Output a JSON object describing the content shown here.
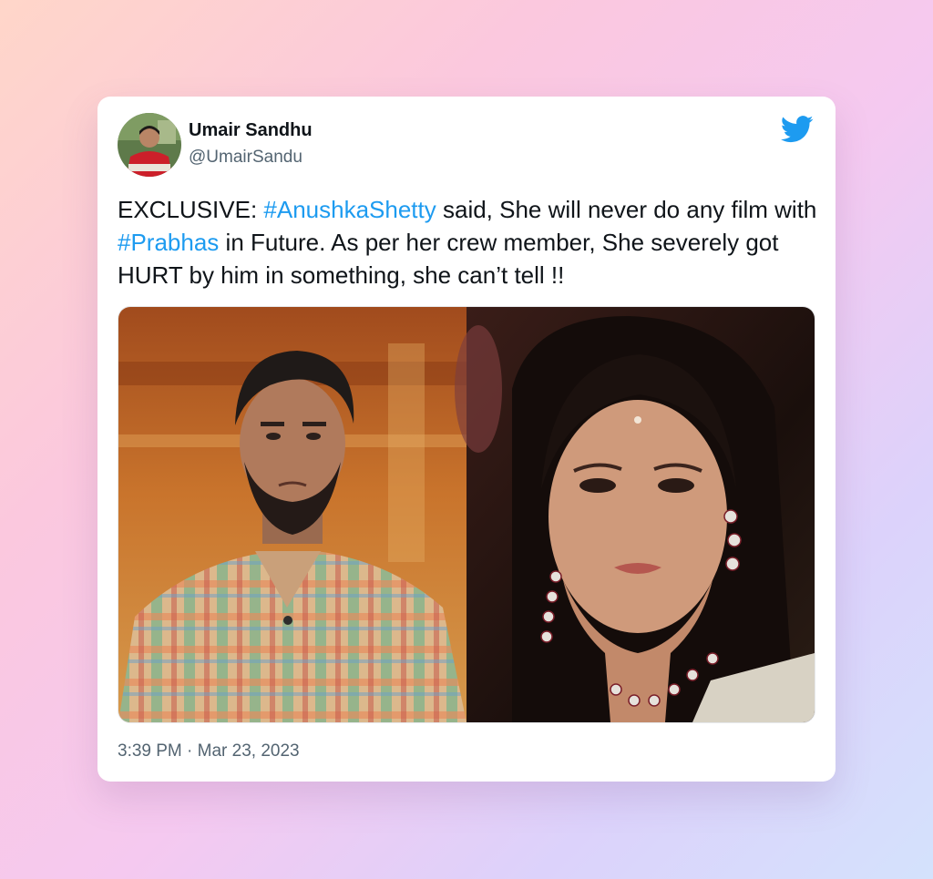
{
  "tweet": {
    "author": {
      "display_name": "Umair Sandhu",
      "handle": "@UmairSandu",
      "avatar": "profile-photo"
    },
    "icons": {
      "brand": "twitter-bird-icon",
      "brand_color": "#1d9bf0"
    },
    "text_parts": {
      "p1": "EXCLUSIVE: ",
      "tag1": "#AnushkaShetty",
      "p2": " said, She will never do any film with ",
      "tag2": "#Prabhas",
      "p3": " in Future. As per her crew member, She severely got HURT by him in something, she can’t tell !!"
    },
    "media": {
      "left_photo": "man-with-beard-plaid-shirt",
      "right_photo": "woman-with-jewelry"
    },
    "timestamp": "3:39 PM · Mar 23, 2023"
  }
}
